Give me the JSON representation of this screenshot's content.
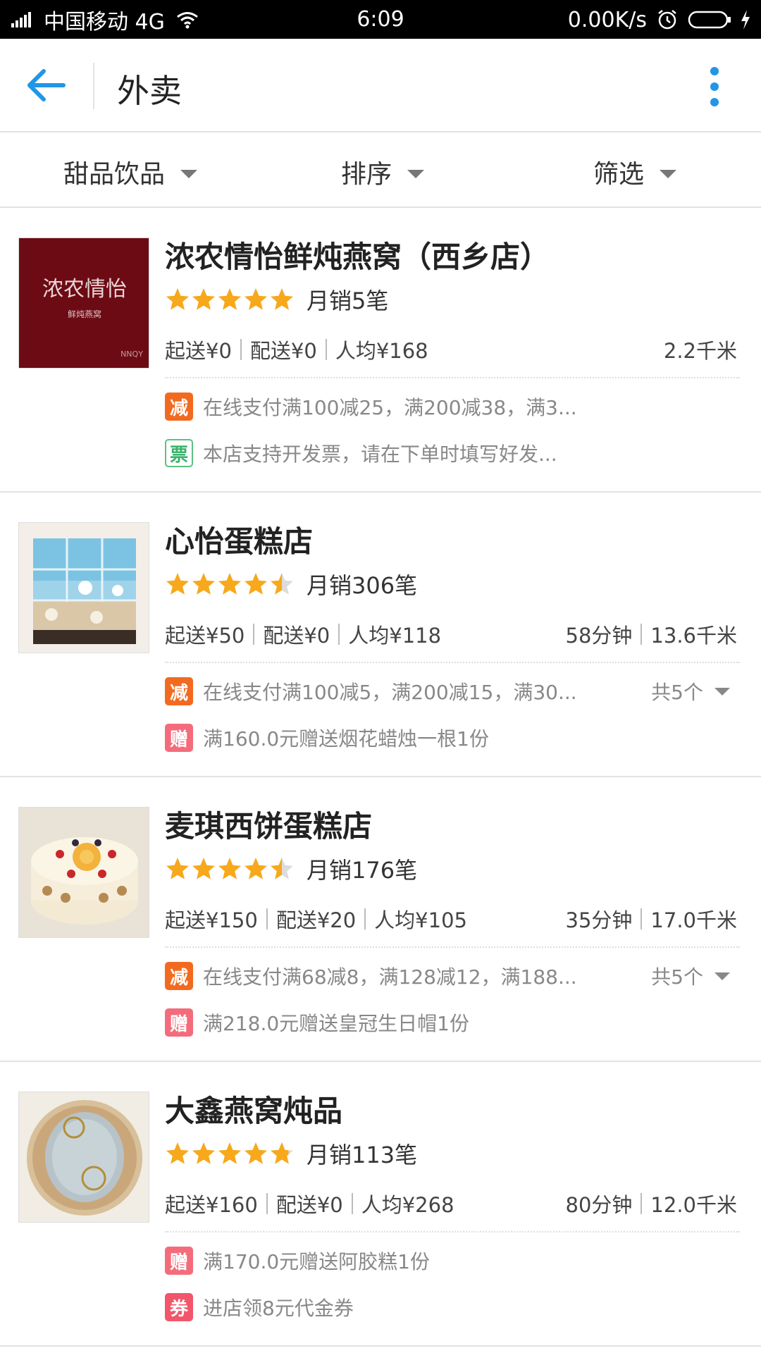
{
  "status_bar": {
    "carrier": "中国移动 4G",
    "time": "6:09",
    "net_speed": "0.00K/s"
  },
  "app_bar": {
    "title": "外卖",
    "back_icon": "arrow-left-icon",
    "more_icon": "vertical-dots-icon",
    "accent": "#2196e6"
  },
  "filters": [
    {
      "label": "甜品饮品"
    },
    {
      "label": "排序"
    },
    {
      "label": "筛选"
    }
  ],
  "shops": [
    {
      "name": "浓农情怡鲜炖燕窝（西乡店）",
      "rating": 5,
      "sales": "月销5笔",
      "min_order": "起送¥0",
      "delivery_fee": "配送¥0",
      "per_person": "人均¥168",
      "time": "",
      "distance": "2.2千米",
      "promos": [
        {
          "badge": "减",
          "type": "jian",
          "text": "在线支付满100减25，满200减38，满3..."
        },
        {
          "badge": "票",
          "type": "piao",
          "text": "本店支持开发票，请在下单时填写好发..."
        }
      ],
      "count": "",
      "logo_text": "浓农情怡",
      "logo_sub": "鲜炖燕窝",
      "logo_tag": "NNQY"
    },
    {
      "name": "心怡蛋糕店",
      "rating": 4.5,
      "sales": "月销306笔",
      "min_order": "起送¥50",
      "delivery_fee": "配送¥0",
      "per_person": "人均¥118",
      "time": "58分钟",
      "distance": "13.6千米",
      "promos": [
        {
          "badge": "减",
          "type": "jian",
          "text": "在线支付满100减5，满200减15，满30..."
        },
        {
          "badge": "赠",
          "type": "zeng",
          "text": "满160.0元赠送烟花蜡烛一根1份"
        }
      ],
      "count": "共5个"
    },
    {
      "name": "麦琪西饼蛋糕店",
      "rating": 4.5,
      "sales": "月销176笔",
      "min_order": "起送¥150",
      "delivery_fee": "配送¥20",
      "per_person": "人均¥105",
      "time": "35分钟",
      "distance": "17.0千米",
      "promos": [
        {
          "badge": "减",
          "type": "jian",
          "text": "在线支付满68减8，满128减12，满188..."
        },
        {
          "badge": "赠",
          "type": "zeng",
          "text": "满218.0元赠送皇冠生日帽1份"
        }
      ],
      "count": "共5个"
    },
    {
      "name": "大鑫燕窝炖品",
      "rating": 4.8,
      "sales": "月销113笔",
      "min_order": "起送¥160",
      "delivery_fee": "配送¥0",
      "per_person": "人均¥268",
      "time": "80分钟",
      "distance": "12.0千米",
      "promos": [
        {
          "badge": "赠",
          "type": "zeng",
          "text": "满170.0元赠送阿胶糕1份"
        },
        {
          "badge": "券",
          "type": "quan",
          "text": "进店领8元代金券"
        }
      ],
      "count": ""
    }
  ]
}
